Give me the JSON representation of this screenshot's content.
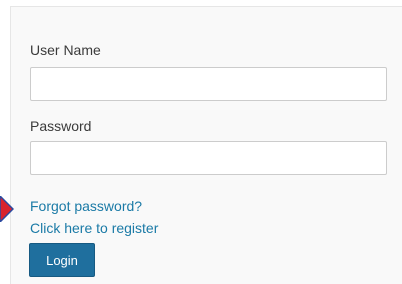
{
  "form": {
    "username_label": "User Name",
    "username_value": "",
    "password_label": "Password",
    "password_value": "",
    "forgot_password_link": "Forgot password?",
    "register_link": "Click here to register",
    "login_button": "Login"
  },
  "annotation": {
    "arrow_icon": "red-pointer-arrow-icon",
    "arrow_color": "#d9232e",
    "arrow_outline_color": "#2b4aa0"
  },
  "colors": {
    "link": "#1a7aa6",
    "button": "#1f6f9e",
    "panel_bg": "#f9f9f9"
  }
}
